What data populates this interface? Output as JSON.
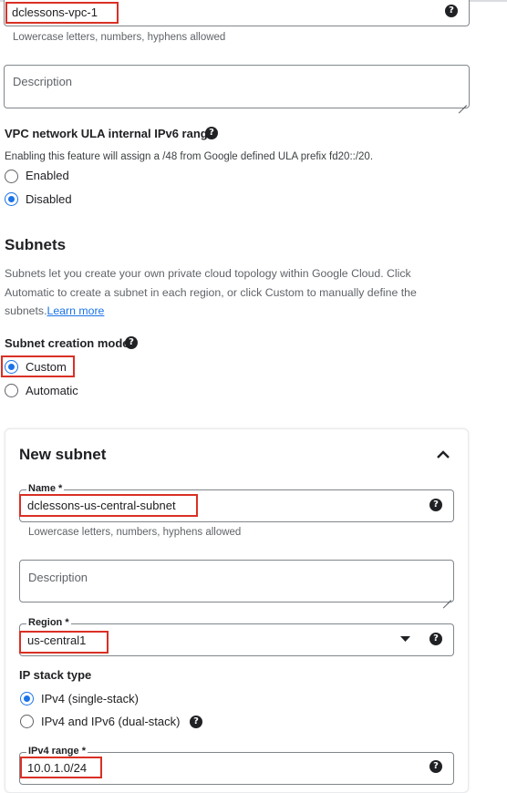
{
  "network": {
    "name_value": "dclessons-vpc-1",
    "name_hint": "Lowercase letters, numbers, hyphens allowed",
    "description_placeholder": "Description"
  },
  "ula": {
    "title": "VPC network ULA internal IPv6 range",
    "description": "Enabling this feature will assign a /48 from Google defined ULA prefix fd20::/20.",
    "options": [
      {
        "label": "Enabled",
        "selected": false
      },
      {
        "label": "Disabled",
        "selected": true
      }
    ]
  },
  "subnets": {
    "heading": "Subnets",
    "description": "Subnets let you create your own private cloud topology within Google Cloud. Click Automatic to create a subnet in each region, or click Custom to manually define the subnets.",
    "description_line1": "Subnets let you create your own private cloud topology within Google Cloud. Click",
    "description_line2": "Automatic to create a subnet in each region, or click Custom to manually define the",
    "description_line3": "subnets.",
    "learn_more": "Learn more",
    "mode_title": "Subnet creation mode",
    "mode_options": [
      {
        "label": "Custom",
        "selected": true
      },
      {
        "label": "Automatic",
        "selected": false
      }
    ]
  },
  "new_subnet": {
    "title": "New subnet",
    "name_label": "Name *",
    "name_value": "dclessons-us-central-subnet",
    "name_hint": "Lowercase letters, numbers, hyphens allowed",
    "description_placeholder": "Description",
    "region_label": "Region *",
    "region_value": "us-central1",
    "ip_stack_title": "IP stack type",
    "ip_stack_options": [
      {
        "label": "IPv4 (single-stack)",
        "selected": true
      },
      {
        "label": "IPv4 and IPv6 (dual-stack)",
        "selected": false
      }
    ],
    "ipv4_label": "IPv4 range *",
    "ipv4_value": "10.0.1.0/24"
  },
  "icons": {
    "help": "?",
    "chevron_up": "chevron-up-icon",
    "dropdown": "dropdown-arrow-icon"
  },
  "colors": {
    "accent": "#1a73e8",
    "highlight": "#d93025",
    "link": "#1a73e8"
  }
}
